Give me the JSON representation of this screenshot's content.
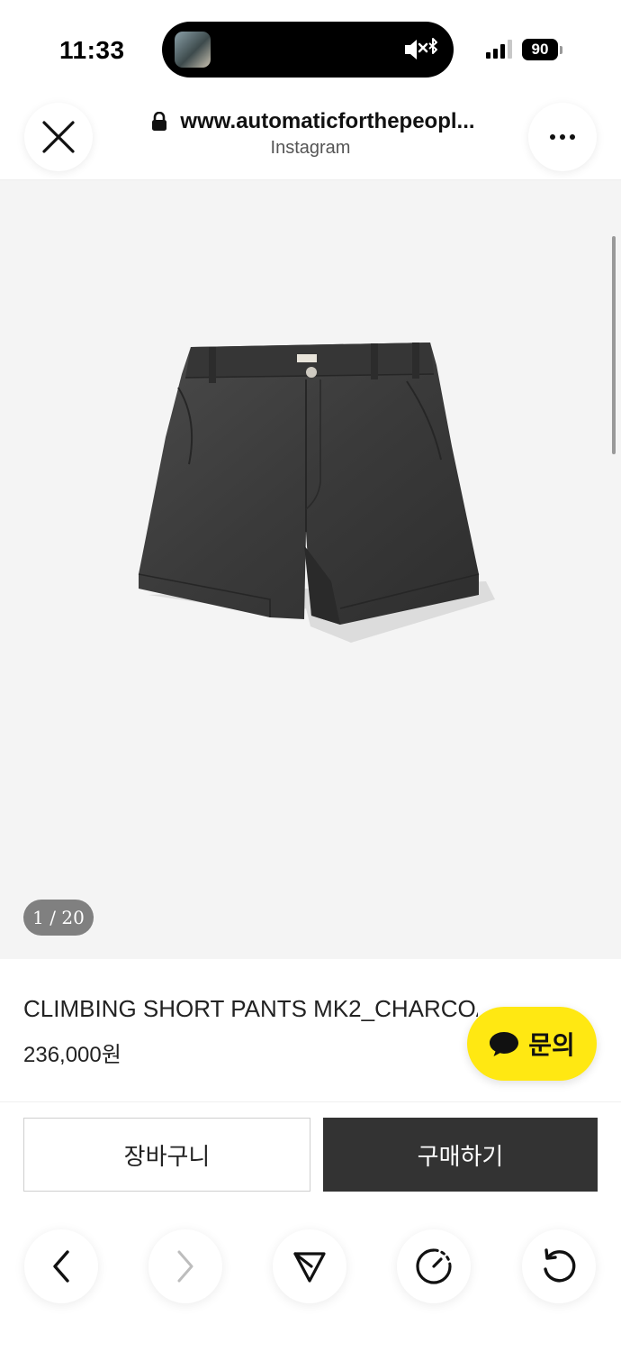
{
  "status_bar": {
    "time": "11:33",
    "battery": "90",
    "icons": [
      "media-thumbnail",
      "mute-icon",
      "bluetooth-icon",
      "signal-icon",
      "battery-icon"
    ]
  },
  "browser": {
    "url": "www.automaticforthepeopl...",
    "source_label": "Instagram",
    "icons": {
      "close": "close-icon",
      "more": "more-icon",
      "lock": "lock-icon"
    }
  },
  "gallery": {
    "counter": "1 / 20",
    "current": 1,
    "total": 20
  },
  "product": {
    "name": "CLIMBING SHORT PANTS MK2_CHARCOAL",
    "price": "236,000원"
  },
  "inquiry": {
    "label": "문의",
    "icon": "chat-bubble-icon",
    "color": "#ffe812"
  },
  "actions": {
    "cart_label": "장바구니",
    "buy_label": "구매하기",
    "buy_color": "#333333"
  },
  "bottom_nav": {
    "icons": [
      "back-icon",
      "forward-icon",
      "share-icon",
      "history-icon",
      "reload-icon"
    ]
  }
}
